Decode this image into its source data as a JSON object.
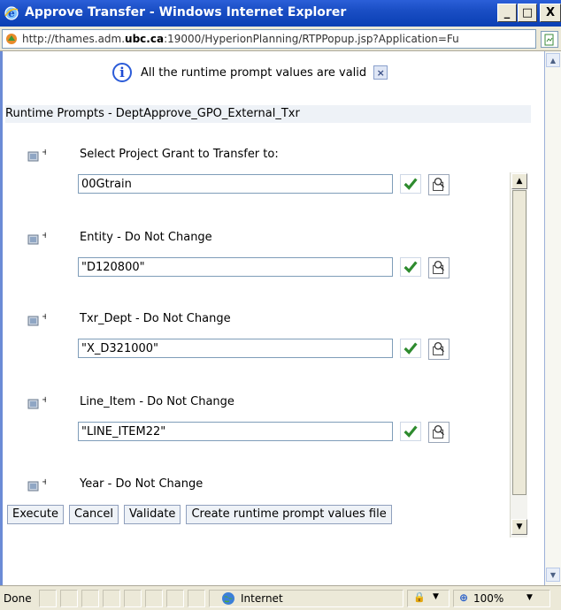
{
  "window": {
    "title": "Approve Transfer - Windows Internet Explorer",
    "min_label": "_",
    "max_label": "□",
    "close_label": "X"
  },
  "address": {
    "url_prefix": "http://thames.adm.",
    "url_domain": "ubc.ca",
    "url_suffix": ":19000/HyperionPlanning/RTPPopup.jsp?Application=Fu"
  },
  "message": {
    "text": "All the runtime prompt values are valid",
    "info_glyph": "i",
    "close_glyph": "×"
  },
  "section": {
    "header": "Runtime Prompts - DeptApprove_GPO_External_Txr"
  },
  "prompts": [
    {
      "label": "Select Project Grant to Transfer to:",
      "value": "00Gtrain"
    },
    {
      "label": "Entity - Do Not Change",
      "value": "\"D120800\""
    },
    {
      "label": "Txr_Dept - Do Not Change",
      "value": "\"X_D321000\""
    },
    {
      "label": "Line_Item - Do Not Change",
      "value": "\"LINE_ITEM22\""
    },
    {
      "label": "Year - Do Not Change",
      "value": ""
    }
  ],
  "buttons": {
    "execute": "Execute",
    "cancel": "Cancel",
    "validate": "Validate",
    "create_file": "Create runtime prompt values file"
  },
  "status": {
    "state": "Done",
    "zone": "Internet",
    "zoom": "100%"
  },
  "colors": {
    "titlebar": "#1a4ec4",
    "check_green": "#2e8b2e",
    "info_blue": "#2b5bd8"
  },
  "icons": {
    "prompt": "member-select-icon",
    "check": "check-icon",
    "lookup": "member-lookup-icon",
    "info": "info-icon",
    "globe": "globe-icon"
  }
}
